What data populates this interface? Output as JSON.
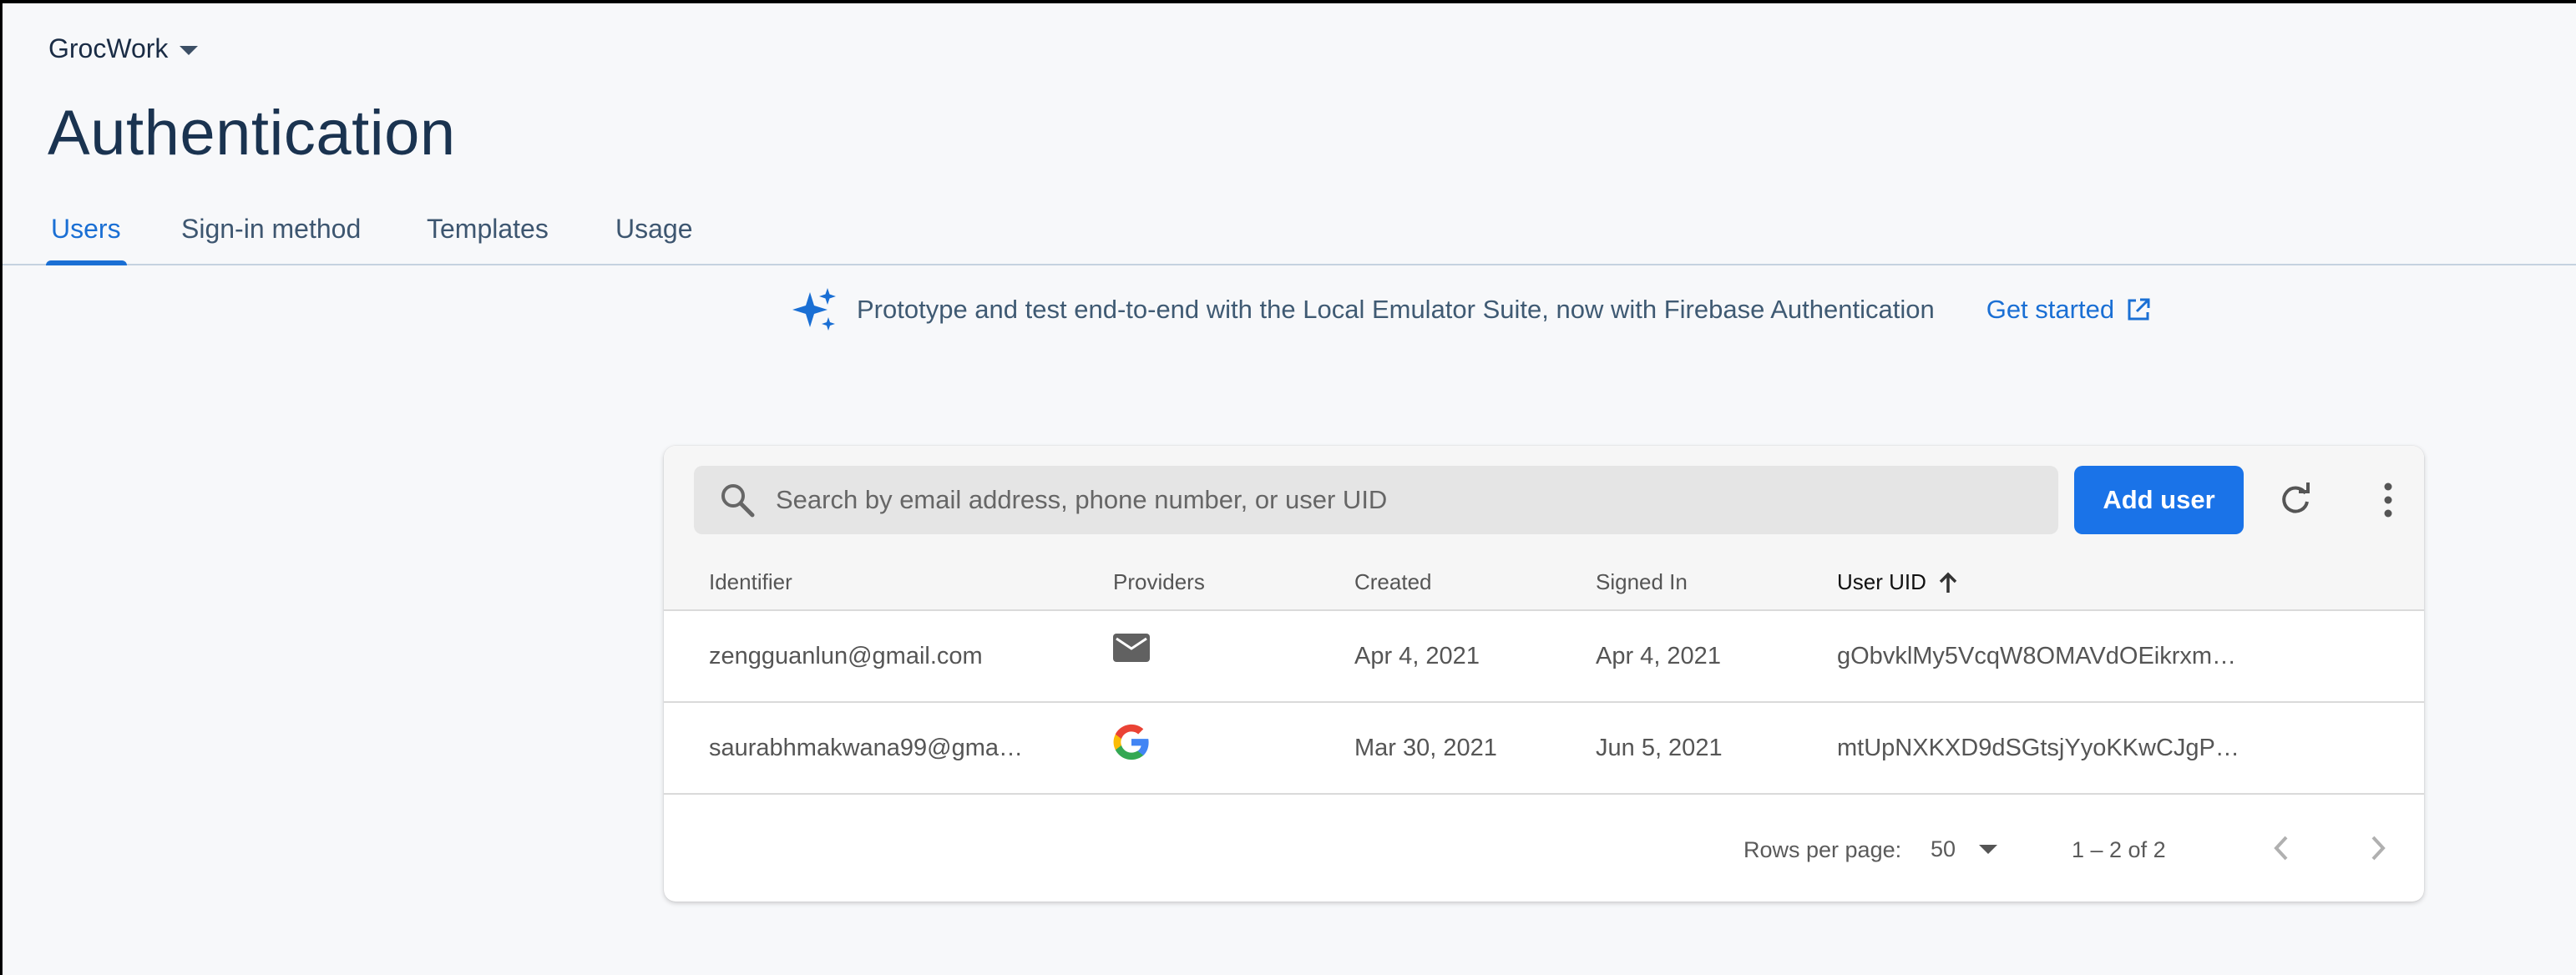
{
  "project": {
    "name": "GrocWork",
    "dropdown_icon": "caret-down-icon"
  },
  "page": {
    "title": "Authentication"
  },
  "tabs": [
    {
      "label": "Users",
      "active": true
    },
    {
      "label": "Sign-in method",
      "active": false
    },
    {
      "label": "Templates",
      "active": false
    },
    {
      "label": "Usage",
      "active": false
    }
  ],
  "promo": {
    "icon": "sparkle-icon",
    "text": "Prototype and test end-to-end with the Local Emulator Suite, now with Firebase Authentication",
    "link_label": "Get started",
    "link_icon": "open-in-new-icon"
  },
  "users_table": {
    "search_placeholder": "Search by email address, phone number, or user UID",
    "add_user_label": "Add user",
    "refresh_icon": "refresh-icon",
    "more_icon": "more-vertical-icon",
    "columns": [
      "Identifier",
      "Providers",
      "Created",
      "Signed In",
      "User UID"
    ],
    "sorted_column": "User UID",
    "sort_direction": "ascending",
    "rows": [
      {
        "identifier": "zengguanlun@gmail.com",
        "provider": "email-icon",
        "created": "Apr 4, 2021",
        "signed_in": "Apr 4, 2021",
        "uid": "gObvklMy5VcqW8OMAVdOEikrxm…"
      },
      {
        "identifier": "saurabhmakwana99@gma…",
        "provider": "google-icon",
        "created": "Mar 30, 2021",
        "signed_in": "Jun 5, 2021",
        "uid": "mtUpNXKXD9dSGtsjYyoKKwCJgP…"
      }
    ],
    "pagination": {
      "rows_per_page_label": "Rows per page:",
      "rows_per_page_value": "50",
      "range_label": "1 – 2 of 2"
    }
  },
  "colors": {
    "accent": "#1a73e8",
    "tab_active": "#1a6fd4",
    "page_background": "#f7f8fa"
  }
}
